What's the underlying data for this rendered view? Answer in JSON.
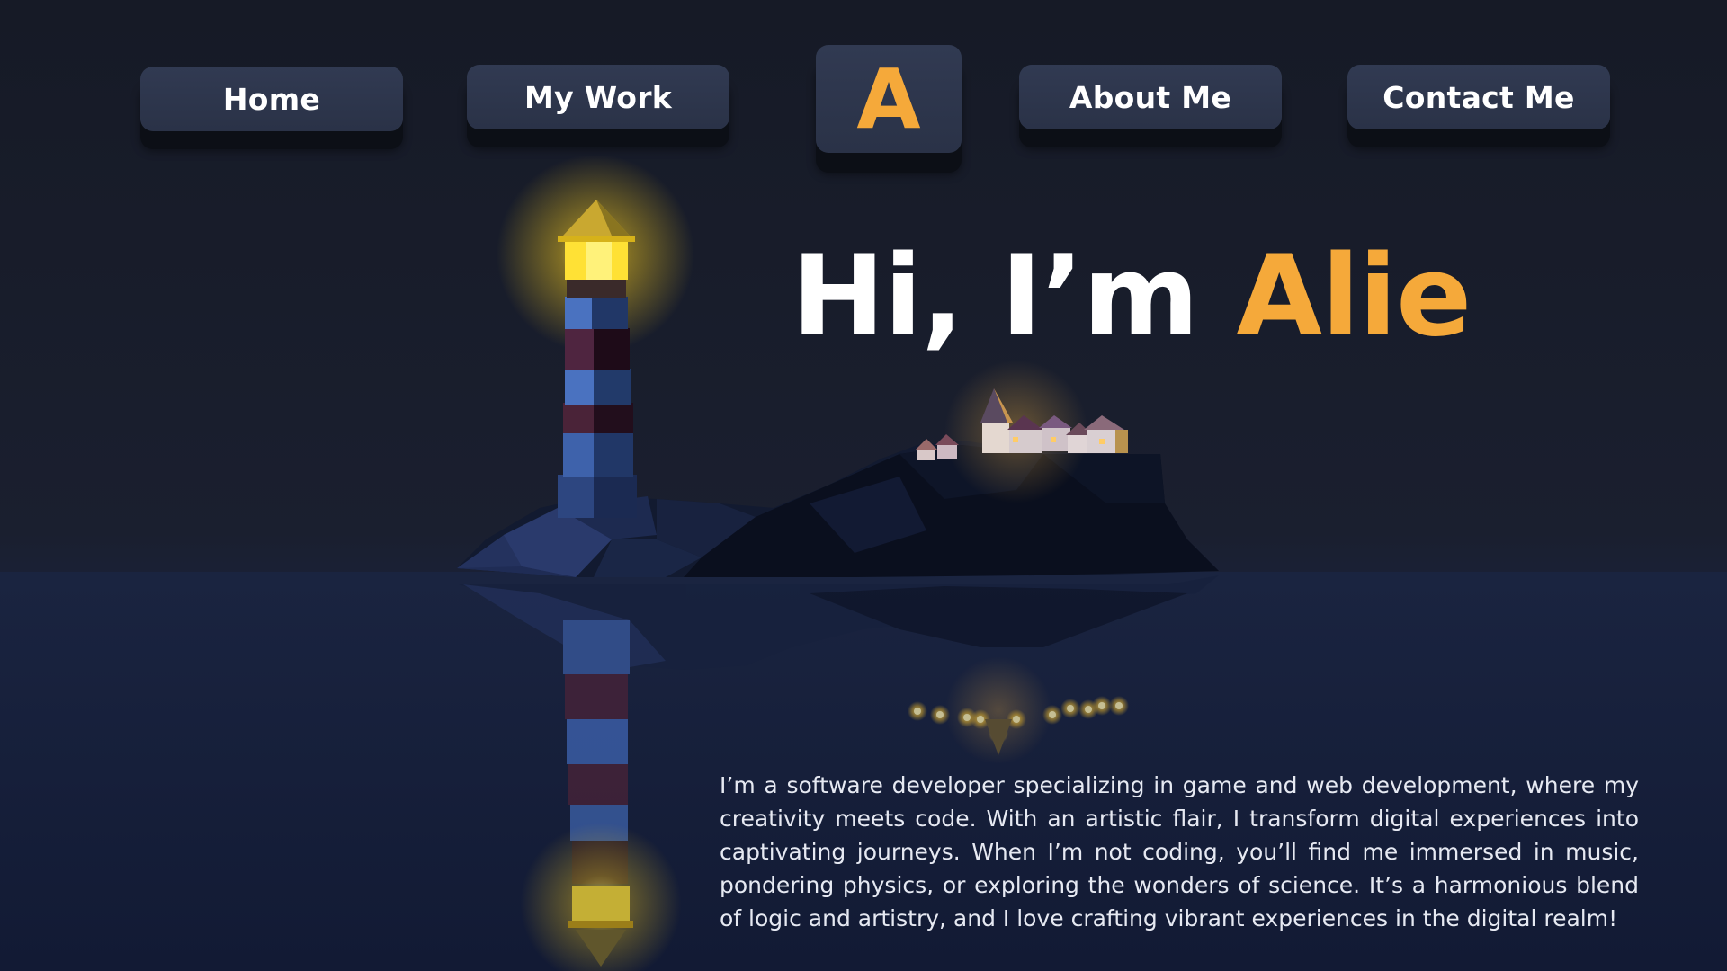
{
  "nav": {
    "home_label": "Home",
    "work_label": "My Work",
    "logo_letter": "A",
    "about_label": "About Me",
    "contact_label": "Contact Me"
  },
  "hero": {
    "greeting": "Hi, I’m ",
    "name": "Alie",
    "bio": "I’m a software developer specializing in game and web development, where my creativity meets code. With an artistic flair, I transform digital experiences into captivating journeys. When I’m not coding, you’ll find me immersed in music, pondering physics, or exploring the wonders of science. It’s a harmonious blend of logic and artistry, and I love crafting vibrant experiences in the digital realm!"
  },
  "colors": {
    "accent": "#f5a93a",
    "background": "#171b29",
    "button": "#2d354b",
    "water": "#141c36",
    "lamp_glow": "#ffe135"
  },
  "scene": {
    "illustration": "low-poly lighthouse and island village at night reflected in water"
  }
}
